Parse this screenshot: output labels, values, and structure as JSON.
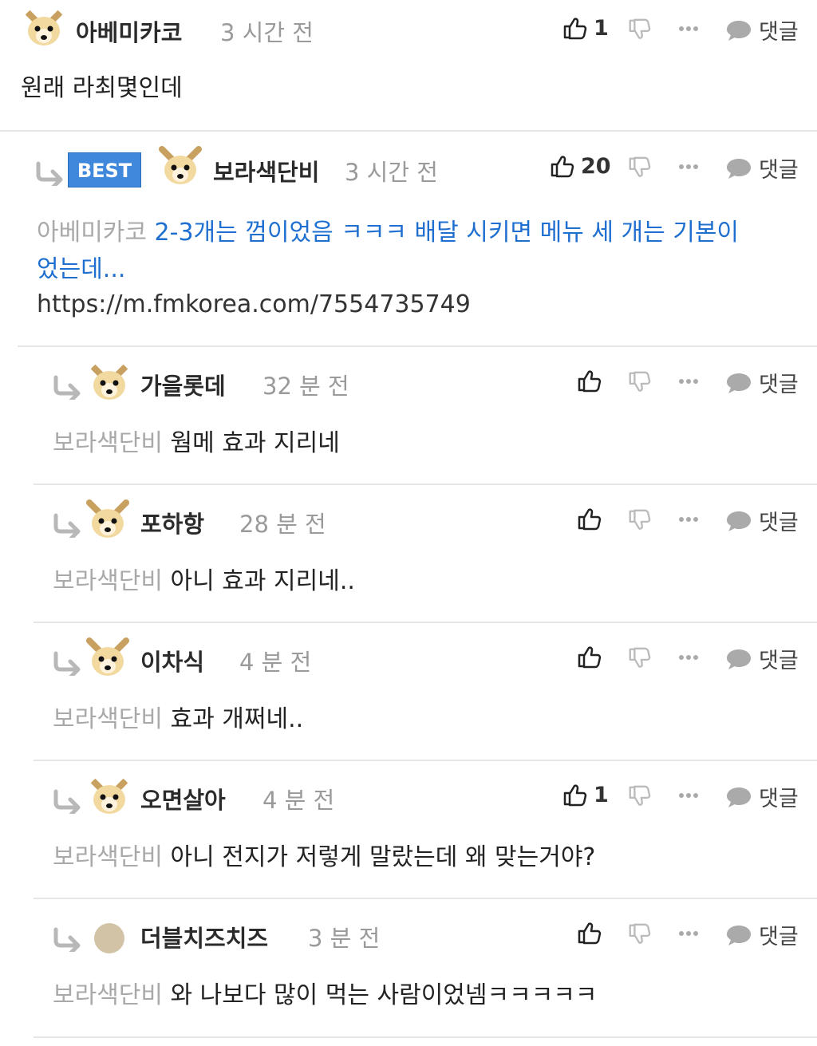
{
  "comments": [
    {
      "username": "아베미카코",
      "time": "3 시간 전",
      "like_count": "1",
      "reply_label": "댓글",
      "text": "원래 라최몇인데"
    },
    {
      "badge": "BEST",
      "username": "보라색단비",
      "time": "3 시간 전",
      "like_count": "20",
      "reply_label": "댓글",
      "mention": "아베미카코",
      "link_text_line1": "2-3개는 껌이었음 ㅋㅋㅋ 배달 시키면 메뉴 세 개는 기본이",
      "link_text_line2": "었는데...",
      "url": "https://m.fmkorea.com/7554735749"
    },
    {
      "username": "가을롯데",
      "time": "32 분 전",
      "like_count": "",
      "reply_label": "댓글",
      "mention": "보라색단비",
      "text": "웜메 효과 지리네"
    },
    {
      "username": "포하항",
      "time": "28 분 전",
      "like_count": "",
      "reply_label": "댓글",
      "mention": "보라색단비",
      "text": "아니 효과 지리네.."
    },
    {
      "username": "이차식",
      "time": "4 분 전",
      "like_count": "",
      "reply_label": "댓글",
      "mention": "보라색단비",
      "text": "효과 개쩌네.."
    },
    {
      "username": "오면살아",
      "time": "4 분 전",
      "like_count": "1",
      "reply_label": "댓글",
      "mention": "보라색단비",
      "text": "아니 전지가 저렇게 말랐는데 왜 맞는거야?"
    },
    {
      "username": "더블치즈치즈",
      "time": "3 분 전",
      "like_count": "",
      "reply_label": "댓글",
      "mention": "보라색단비",
      "text": "와 나보다 많이 먹는 사람이었넴ㅋㅋㅋㅋㅋ"
    }
  ]
}
